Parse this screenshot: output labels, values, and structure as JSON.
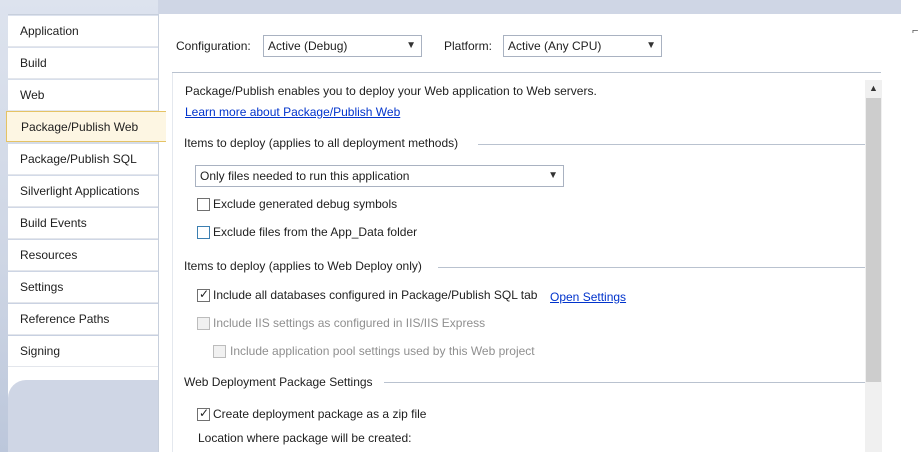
{
  "sidebar": {
    "tabs": [
      {
        "label": "Application"
      },
      {
        "label": "Build"
      },
      {
        "label": "Web"
      },
      {
        "label": "Package/Publish Web",
        "selected": true
      },
      {
        "label": "Package/Publish SQL"
      },
      {
        "label": "Silverlight Applications"
      },
      {
        "label": "Build Events"
      },
      {
        "label": "Resources"
      },
      {
        "label": "Settings"
      },
      {
        "label": "Reference Paths"
      },
      {
        "label": "Signing"
      }
    ]
  },
  "header": {
    "configuration_label": "Configuration:",
    "configuration_value": "Active (Debug)",
    "platform_label": "Platform:",
    "platform_value": "Active (Any CPU)"
  },
  "main": {
    "intro": "Package/Publish enables you to deploy your Web application to Web servers.",
    "learn_more_link": "Learn more about Package/Publish Web",
    "items_all_heading": "Items to deploy (applies to all deployment methods)",
    "items_dropdown_value": "Only files needed to run this application",
    "exclude_debug_label": "Exclude generated debug symbols",
    "exclude_debug_checked": false,
    "exclude_appdata_label": "Exclude files from the App_Data folder",
    "exclude_appdata_checked": false,
    "items_webdeploy_heading": "Items to deploy (applies to Web Deploy only)",
    "include_db_label": "Include all databases configured in Package/Publish SQL tab",
    "include_db_checked": true,
    "open_settings_link": "Open Settings",
    "include_iis_label": "Include IIS settings as configured in IIS/IIS Express",
    "include_iis_checked": false,
    "include_apppool_label": "Include application pool settings used by this Web project",
    "include_apppool_checked": false,
    "package_settings_heading": "Web Deployment Package Settings",
    "create_zip_label": "Create deployment package as a zip file",
    "create_zip_checked": true,
    "location_label": "Location where package will be created:"
  },
  "colors": {
    "link": "#0033cc",
    "selected_tab_border": "#e5c365",
    "selected_tab_bg": "#fdf6e3"
  }
}
